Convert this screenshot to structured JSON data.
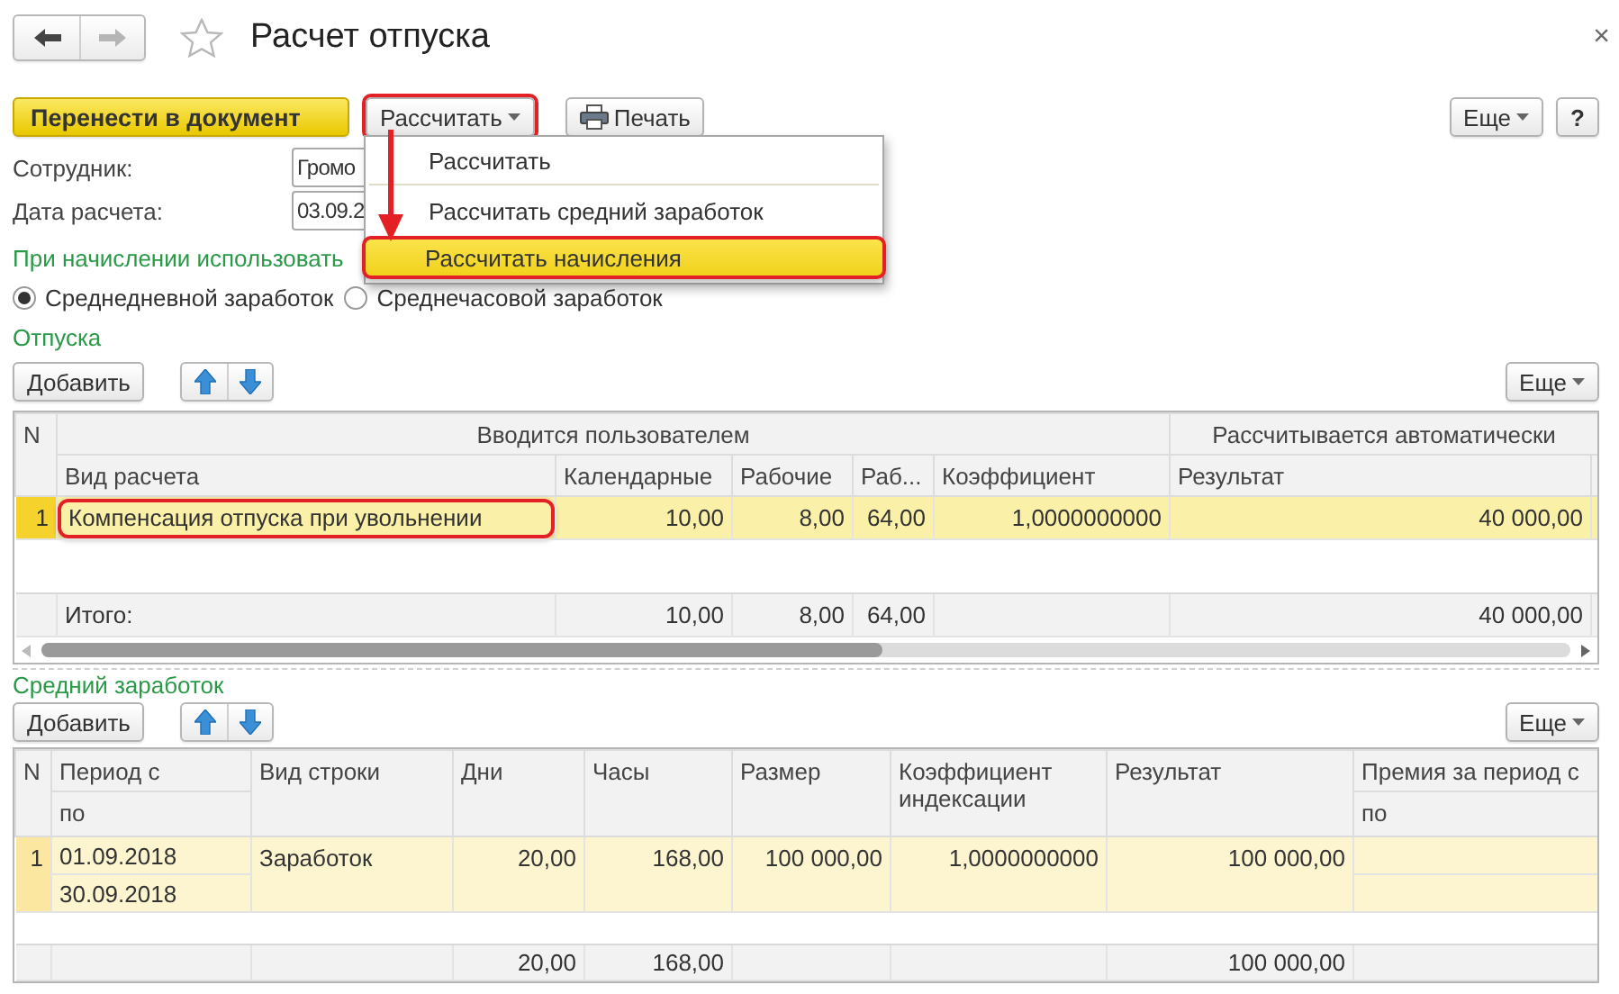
{
  "navigation": {
    "back": {
      "disabled": false
    },
    "forward": {
      "disabled": true
    }
  },
  "window": {
    "title": "Расчет отпуска",
    "favorite": false,
    "close": "×"
  },
  "toolbar": {
    "buttons": [
      {
        "label": "Перенести в документ",
        "kind": "primary",
        "highlighted": false
      },
      {
        "label": "Рассчитать",
        "kind": "dropdown",
        "highlighted": true
      },
      {
        "label": "Печать",
        "kind": "print",
        "highlighted": false
      }
    ],
    "more": "Еще",
    "help": "?"
  },
  "menu": {
    "items": [
      {
        "label": "Рассчитать",
        "selected": false
      },
      {
        "label": "Рассчитать средний заработок",
        "selected": false
      },
      {
        "label": "Рассчитать начисления",
        "selected": true
      }
    ]
  },
  "fields": [
    {
      "label": "Сотрудник:",
      "value": "Громо"
    },
    {
      "label": "Дата расчета:",
      "value": "03.09.2"
    }
  ],
  "accrual": {
    "title": "При начислении использовать",
    "options": [
      {
        "label": "Среднедневной заработок",
        "selected": true
      },
      {
        "label": "Среднечасовой заработок",
        "selected": false
      }
    ]
  },
  "vacations": {
    "title": "Отпуска",
    "add": "Добавить",
    "more": "Еще",
    "groups": [
      "Вводится пользователем",
      "Рассчитывается автоматически"
    ],
    "columns": [
      "N",
      "Вид расчета",
      "Календарные",
      "Рабочие",
      "Раб...",
      "Коэффициент",
      "Результат"
    ],
    "rows": [
      {
        "number": "1",
        "calc_type": "Компенсация отпуска при увольнении",
        "calendar": "10,00",
        "working": "8,00",
        "column_5": "64,00",
        "coefficient": "1,0000000000",
        "result": "40 000,00",
        "selected": true,
        "highlighted": true
      }
    ],
    "totals": {
      "label": "Итого:",
      "calendar": "10,00",
      "working": "8,00",
      "column_5": "64,00",
      "result": "40 000,00"
    }
  },
  "average_earnings": {
    "title": "Средний заработок",
    "add": "Добавить",
    "more": "Еще",
    "columns": [
      {
        "label": "N"
      },
      {
        "label": "Период с",
        "sub": "по"
      },
      {
        "label": "Вид строки"
      },
      {
        "label": "Дни"
      },
      {
        "label": "Часы"
      },
      {
        "label": "Размер"
      },
      {
        "label": "Коэффициент индексации"
      },
      {
        "label": "Результат"
      },
      {
        "label": "Премия за период с",
        "sub": "по"
      }
    ],
    "rows": [
      {
        "number": "1",
        "period_from": "01.09.2018",
        "period_to": "30.09.2018",
        "line_type": "Заработок",
        "days": "20,00",
        "hours": "168,00",
        "amount": "100 000,00",
        "index_coef": "1,0000000000",
        "result": "100 000,00",
        "selected": true
      }
    ],
    "totals": {
      "days": "20,00",
      "hours": "168,00",
      "result": "100 000,00"
    }
  }
}
